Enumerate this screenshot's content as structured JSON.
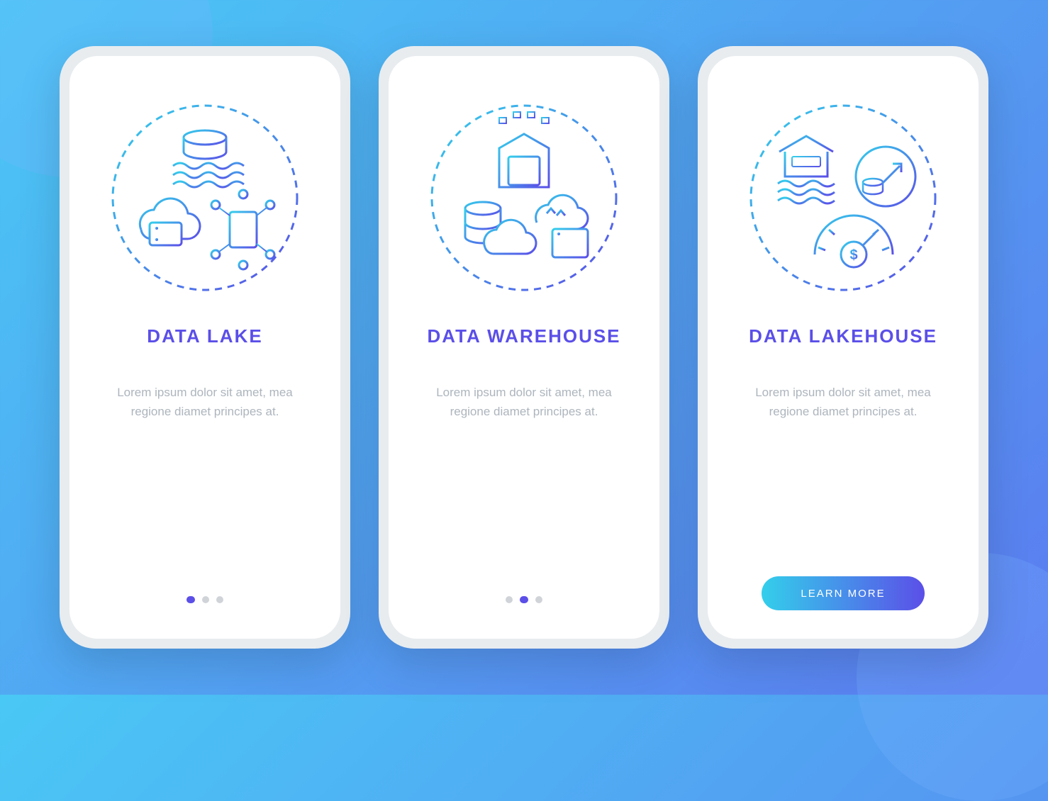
{
  "screens": [
    {
      "title": "DATA LAKE",
      "description": "Lorem ipsum dolor sit amet, mea regione diamet principes at.",
      "icon": "data-lake-icon",
      "pagination": {
        "total": 3,
        "active": 0
      }
    },
    {
      "title": "DATA WAREHOUSE",
      "description": "Lorem ipsum dolor sit amet, mea regione diamet principes at.",
      "icon": "data-warehouse-icon",
      "pagination": {
        "total": 3,
        "active": 1
      }
    },
    {
      "title": "DATA LAKEHOUSE",
      "description": "Lorem ipsum dolor sit amet, mea regione diamet principes at.",
      "icon": "data-lakehouse-icon",
      "cta_label": "LEARN MORE"
    }
  ],
  "colors": {
    "accent": "#5B4FE8",
    "gradient_start": "#33CFEB",
    "gradient_end": "#5B4FE8",
    "text_muted": "#ADB5BD"
  }
}
